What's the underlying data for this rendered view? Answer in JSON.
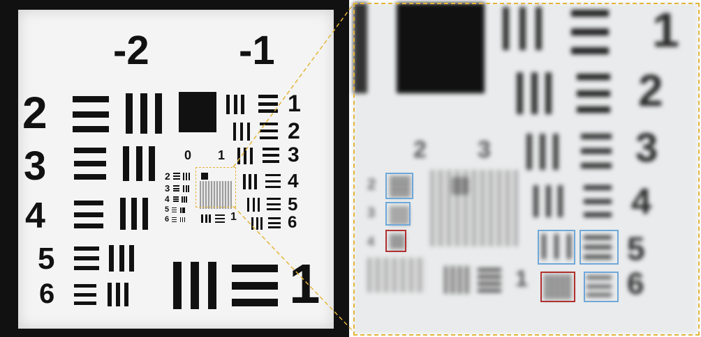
{
  "image_title": "",
  "left": {
    "big_group_labels": [
      "-2",
      "-1"
    ],
    "coarse_element_labels": [
      "2",
      "3",
      "4",
      "5",
      "6"
    ],
    "mid_group_labels": [
      "0",
      "1"
    ],
    "mid_element_labels": [
      "1",
      "2",
      "3",
      "4",
      "5",
      "6"
    ],
    "inner_element_labels": [
      "2",
      "3",
      "4",
      "5",
      "6",
      "1"
    ],
    "bottom_label": "1"
  },
  "zoom": {
    "right_labels": [
      "1",
      "2",
      "3",
      "4",
      "5",
      "6"
    ],
    "group_labels": [
      "2",
      "3"
    ],
    "small_labels": [
      "2",
      "3",
      "4"
    ],
    "tiny_label": "1"
  },
  "colors": {
    "highlight_blue": "#6fa8d8",
    "highlight_red": "#b03030",
    "guide_yellow": "#e5b53a"
  }
}
